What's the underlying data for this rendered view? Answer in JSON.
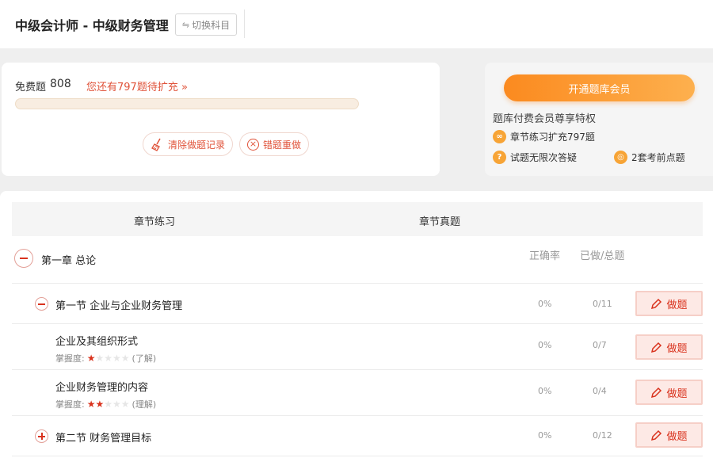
{
  "header": {
    "title": "中级会计师 - 中级财务管理",
    "switch_label": "切换科目",
    "switch_icon": "swap-icon"
  },
  "free_card": {
    "label": "免费题",
    "count": "808",
    "expand_text": "您还有797题待扩充 »",
    "progress": 0.0,
    "clear_label": "清除做题记录",
    "redo_label": "错题重做"
  },
  "vip": {
    "button_label": "开通题库会员",
    "privilege_title": "题库付费会员尊享特权",
    "items": [
      {
        "text": "章节练习扩充797题",
        "icon": "infinity-icon",
        "glyph": "∞"
      },
      {
        "text": "试题无限次答疑",
        "icon": "question-icon",
        "glyph": "?"
      },
      {
        "text": "2套考前点题",
        "icon": "target-icon",
        "glyph": "◎"
      }
    ]
  },
  "tabs": [
    {
      "label": "章节练习"
    },
    {
      "label": "章节真题"
    }
  ],
  "columns": {
    "accuracy": "正确率",
    "done_total": "已做/总题"
  },
  "chapter": {
    "title": "第一章 总论"
  },
  "do_label": "做题",
  "rows": [
    {
      "kind": "section",
      "expanded": true,
      "title": "第一节 企业与企业财务管理",
      "rate": "0%",
      "count": "0/11"
    },
    {
      "kind": "point",
      "title": "企业及其组织形式",
      "mastery_label": "掌握度:",
      "stars": 1,
      "level": "(了解)",
      "rate": "0%",
      "count": "0/7"
    },
    {
      "kind": "point",
      "title": "企业财务管理的内容",
      "mastery_label": "掌握度:",
      "stars": 2,
      "level": "(理解)",
      "rate": "0%",
      "count": "0/4"
    },
    {
      "kind": "section",
      "expanded": false,
      "title": "第二节 财务管理目标",
      "rate": "0%",
      "count": "0/12"
    }
  ]
}
